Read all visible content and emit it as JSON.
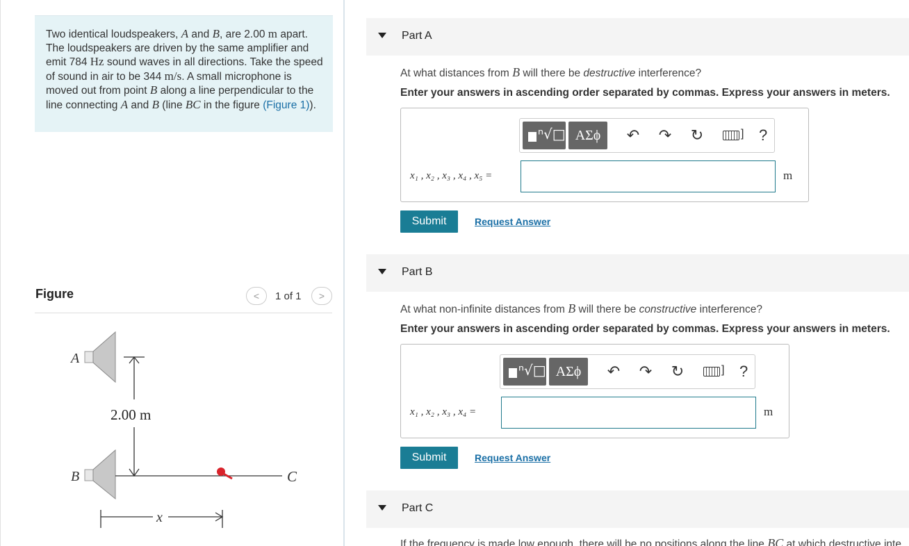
{
  "problem": {
    "text_1": "Two identical loudspeakers, ",
    "var_A": "A",
    "text_2": " and ",
    "var_B": "B",
    "text_3": ", are 2.00 ",
    "unit_m": "m",
    "text_4": " apart. The loudspeakers are driven by the same amplifier and emit 784 ",
    "unit_hz": "Hz",
    "text_5": " sound waves in all directions. Take the speed of sound in air to be 344 ",
    "unit_ms": "m/s",
    "text_6": ". A small microphone is moved out from point ",
    "text_7": " along a line perpendicular to the line connecting ",
    "text_8": " and ",
    "text_9": " (line ",
    "var_BC": "BC",
    "text_10": " in the figure ",
    "figure_link": "(Figure 1)",
    "text_11": ")."
  },
  "figure": {
    "title": "Figure",
    "pager_text": "1 of 1",
    "prev_glyph": "<",
    "next_glyph": ">",
    "label_A": "A",
    "label_B": "B",
    "label_C": "C",
    "label_x": "x",
    "dimension": "2.00 m"
  },
  "parts": [
    {
      "title": "Part A",
      "q_text_1": "At what distances from ",
      "q_var": "B",
      "q_text_2": " will there be ",
      "q_em": "destructive",
      "q_text_3": " interference?",
      "instruction": "Enter your answers in ascending order separated by commas. Express your answers in meters.",
      "variables": "x₁ , x₂ , x₃ , x₄ , x₅ =",
      "answer_value": "",
      "unit": "m",
      "submit": "Submit",
      "request": "Request Answer"
    },
    {
      "title": "Part B",
      "q_text_1": "At what non-infinite distances from ",
      "q_var": "B",
      "q_text_2": " will there be ",
      "q_em": "constructive",
      "q_text_3": " interference?",
      "instruction": "Enter your answers in ascending order separated by commas. Express your answers in meters.",
      "variables": "x₁ , x₂ , x₃ , x₄ =",
      "answer_value": "",
      "unit": "m",
      "submit": "Submit",
      "request": "Request Answer"
    },
    {
      "title": "Part C",
      "q_text_1": "If the frequency is made low enough, there will be no positions along the line ",
      "q_var": "BC",
      "q_text_2": " at which destructive inte"
    }
  ],
  "toolbar": {
    "templates_glyph": "ⁿ√□",
    "greek_label": "ΑΣϕ",
    "undo_glyph": "↶",
    "redo_glyph": "↷",
    "reset_glyph": "↻",
    "keyboard_bracket": "]",
    "help_glyph": "?"
  },
  "colors": {
    "accent": "#1a7d95",
    "link": "#1a6fa6",
    "problem_bg": "#e5f3f6",
    "part_header_bg": "#f4f4f4",
    "input_border": "#1f7a8c",
    "marker": "#d9232b"
  }
}
